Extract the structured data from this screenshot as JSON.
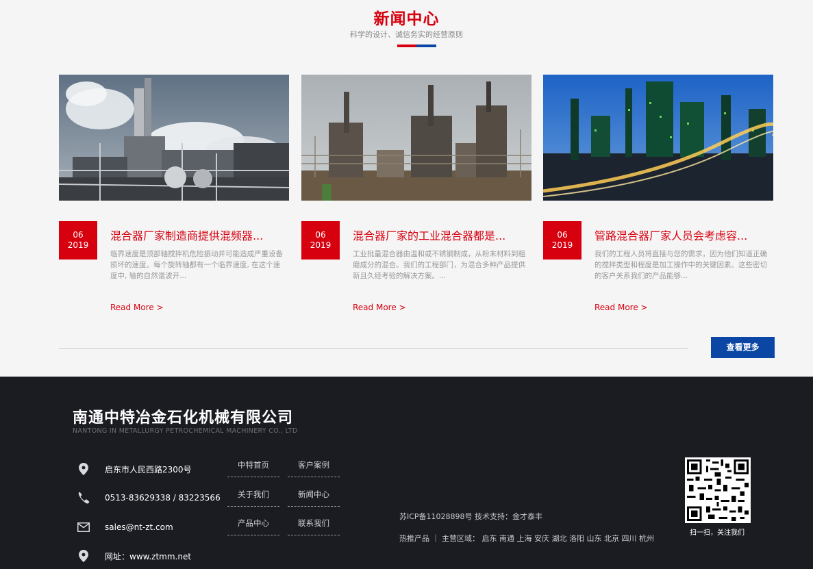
{
  "news": {
    "title": "新闻中心",
    "subtitle": "科学的设计、诚信务实的经营原则",
    "accent_red": "#d7000f",
    "accent_blue": "#0b46a5",
    "cards": [
      {
        "day": "06",
        "year": "2019",
        "title": "混合器厂家制造商提供混频器...",
        "desc": "临界速度是顶部轴搅拌机危险振动并可能造成严重设备损坏的速度。每个旋转轴都有一个临界速度, 在这个速度中, 轴的自然谐波开...",
        "more": "Read More >",
        "image": "industrial-plant-steam-photo"
      },
      {
        "day": "06",
        "year": "2019",
        "title": "混合器厂家的工业混合器都是...",
        "desc": "工业批量混合器由温和或不锈钢制成，从粉末材料到粗磨成分的混合。我们的工程部门，为混合多种产品提供新且久经考验的解决方案。...",
        "more": "Read More >",
        "image": "refinery-daytime-photo"
      },
      {
        "day": "06",
        "year": "2019",
        "title": "管路混合器厂家人员会考虑容...",
        "desc": "我们的工程人员将直接与您的需求，因为他们知道正确的搅拌类型和程度是加工操作中的关键因素。这些密切的客户关系我们的产品能够...",
        "more": "Read More >",
        "image": "refinery-night-photo"
      }
    ],
    "more_button": "查看更多"
  },
  "footer": {
    "company_cn": "南通中特冶金石化机械有限公司",
    "company_en": "NANTONG IN METALLURGY PETROCHEMICAL MACHINERY CO., LTD",
    "contacts": [
      {
        "icon": "location-pin-icon",
        "text": "启东市人民西路2300号"
      },
      {
        "icon": "phone-icon",
        "text": "0513-83629338 / 83223566"
      },
      {
        "icon": "mail-icon",
        "text": "sales@nt-zt.com"
      },
      {
        "icon": "location-pin-icon",
        "text": "网址：www.ztmm.net"
      }
    ],
    "nav": [
      "中特首页",
      "客户案例",
      "关于我们",
      "新闻中心",
      "产品中心",
      "联系我们"
    ],
    "icp": "苏ICP备11028898号 技术支持：金才泰丰",
    "hot": "热推产品 ｜ 主营区域： 启东 南通 上海 安庆 湖北 洛阳 山东 北京 四川 杭州",
    "qr_caption": "扫一扫，关注我们"
  }
}
